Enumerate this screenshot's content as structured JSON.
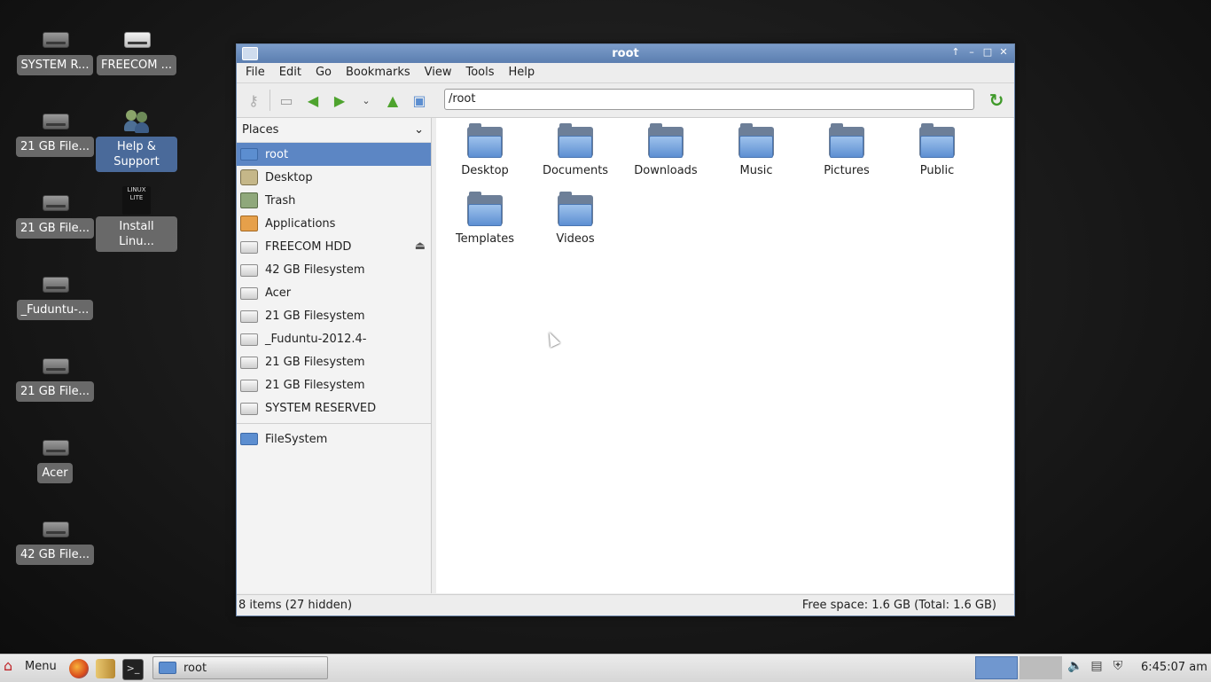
{
  "desktop": {
    "icons": [
      {
        "label": "SYSTEM R...",
        "type": "drive"
      },
      {
        "label": "FREECOM ...",
        "type": "drive-light"
      },
      {
        "label": "21 GB File...",
        "type": "drive"
      },
      {
        "label": "Help & Support",
        "type": "help"
      },
      {
        "label": "21 GB File...",
        "type": "drive"
      },
      {
        "label": "Install Linu...",
        "type": "linux-lite"
      },
      {
        "label": "_Fuduntu-...",
        "type": "drive"
      },
      {
        "label": "21 GB File...",
        "type": "drive"
      },
      {
        "label": "Acer",
        "type": "drive"
      },
      {
        "label": "42 GB File...",
        "type": "drive"
      }
    ],
    "linux_lite_text": "LINUX LITE"
  },
  "window": {
    "title": "root",
    "menu": [
      "File",
      "Edit",
      "Go",
      "Bookmarks",
      "View",
      "Tools",
      "Help"
    ],
    "location": "/root",
    "places_header": "Places",
    "places": [
      {
        "label": "root",
        "icon": "home-folder-icon",
        "active": true
      },
      {
        "label": "Desktop",
        "icon": "desktop-icon"
      },
      {
        "label": "Trash",
        "icon": "trash-icon"
      },
      {
        "label": "Applications",
        "icon": "applications-icon"
      },
      {
        "label": "FREECOM HDD",
        "icon": "drive-icon",
        "eject": true
      },
      {
        "label": "42 GB Filesystem",
        "icon": "drive-icon"
      },
      {
        "label": "Acer",
        "icon": "drive-icon"
      },
      {
        "label": "21 GB Filesystem",
        "icon": "drive-icon"
      },
      {
        "label": "_Fuduntu-2012.4-",
        "icon": "drive-icon"
      },
      {
        "label": "21 GB Filesystem",
        "icon": "drive-icon"
      },
      {
        "label": "21 GB Filesystem",
        "icon": "drive-icon"
      },
      {
        "label": "SYSTEM RESERVED",
        "icon": "drive-icon"
      }
    ],
    "filesystem_label": "FileSystem",
    "folders": [
      "Desktop",
      "Documents",
      "Downloads",
      "Music",
      "Pictures",
      "Public",
      "Templates",
      "Videos"
    ],
    "status_left": "8 items (27 hidden)",
    "status_right": "Free space: 1.6 GB (Total: 1.6 GB)"
  },
  "taskbar": {
    "menu_label": "Menu",
    "task_label": "root",
    "clock": "6:45:07 am"
  },
  "colors": {
    "accent": "#5c86c4",
    "titlebar": "#6b8dbf"
  }
}
